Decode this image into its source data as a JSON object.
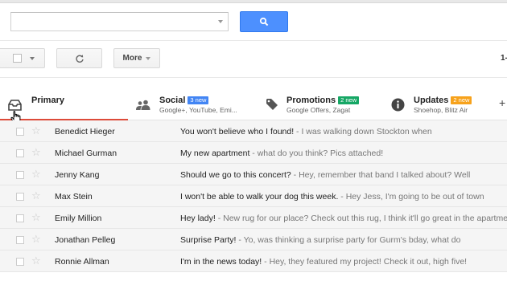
{
  "search": {
    "value": "",
    "placeholder": ""
  },
  "toolbar": {
    "more_label": "More",
    "page_count": "1-"
  },
  "tabs": [
    {
      "name": "Primary",
      "subtitle": "",
      "badge": ""
    },
    {
      "name": "Social",
      "subtitle": "Google+, YouTube, Emi...",
      "badge": "3 new",
      "badge_color": "#4285f4"
    },
    {
      "name": "Promotions",
      "subtitle": "Google Offers, Zagat",
      "badge": "2 new",
      "badge_color": "#16a765"
    },
    {
      "name": "Updates",
      "subtitle": "Shoehop, Blitz Air",
      "badge": "2 new",
      "badge_color": "#f7a21b"
    }
  ],
  "add_tab_label": "+",
  "accent": {
    "primary_tab": "#dd4b39",
    "search_button": "#4d90fe"
  },
  "emails": [
    {
      "sender": "Benedict Hieger",
      "subject": "You won't believe who I found!",
      "snippet": " - I was walking down Stockton when"
    },
    {
      "sender": "Michael Gurman",
      "subject": "My new apartment",
      "snippet": " - what do you think? Pics attached!"
    },
    {
      "sender": "Jenny Kang",
      "subject": "Should we go to this concert?",
      "snippet": " - Hey, remember that band I talked about? Well"
    },
    {
      "sender": "Max Stein",
      "subject": "I won't be able to walk your dog this week.",
      "snippet": " - Hey Jess, I'm going to be out of town"
    },
    {
      "sender": "Emily Million",
      "subject": "Hey lady!",
      "snippet": " - New rug for our place? Check out this rug, I think it'll go great in the apartment"
    },
    {
      "sender": "Jonathan Pelleg",
      "subject": "Surprise Party!",
      "snippet": " - Yo, was thinking a surprise party for Gurm's bday, what do"
    },
    {
      "sender": "Ronnie Allman",
      "subject": "I'm in the news today!",
      "snippet": " - Hey, they featured my project! Check it out, high five!"
    }
  ]
}
